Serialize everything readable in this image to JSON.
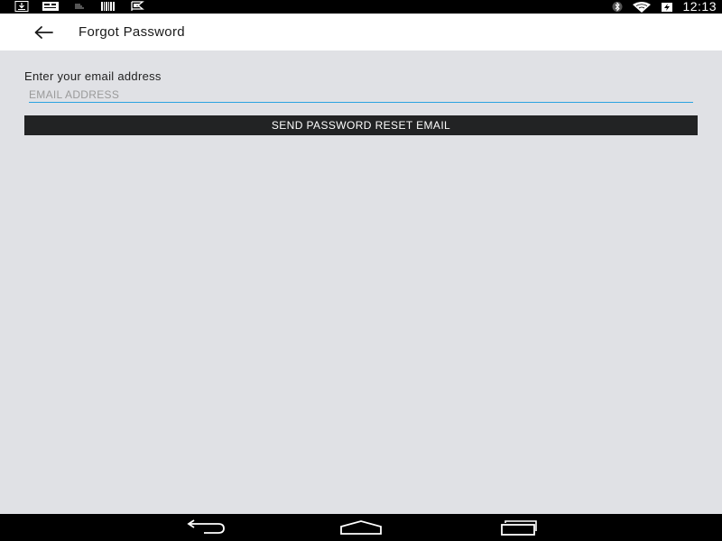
{
  "status_bar": {
    "notification_icons": [
      "download-icon",
      "message-icon",
      "stack-icon",
      "barcode-icon",
      "signal-flag-icon"
    ],
    "system_icons": [
      "bluetooth-icon",
      "wifi-icon",
      "battery-charging-icon"
    ],
    "time": "12:13"
  },
  "app_bar": {
    "back_icon": "arrow-left-icon",
    "title": "Forgot Password"
  },
  "form": {
    "label": "Enter your email address",
    "email_value": "",
    "email_placeholder": "EMAIL ADDRESS",
    "submit_label": "SEND PASSWORD RESET EMAIL"
  },
  "nav_bar": {
    "buttons": [
      "back-icon",
      "home-icon",
      "recents-icon"
    ]
  },
  "colors": {
    "background": "#e0e1e5",
    "app_bar": "#ffffff",
    "accent": "#2aa3e0",
    "button": "#222324",
    "bars": "#000000"
  }
}
